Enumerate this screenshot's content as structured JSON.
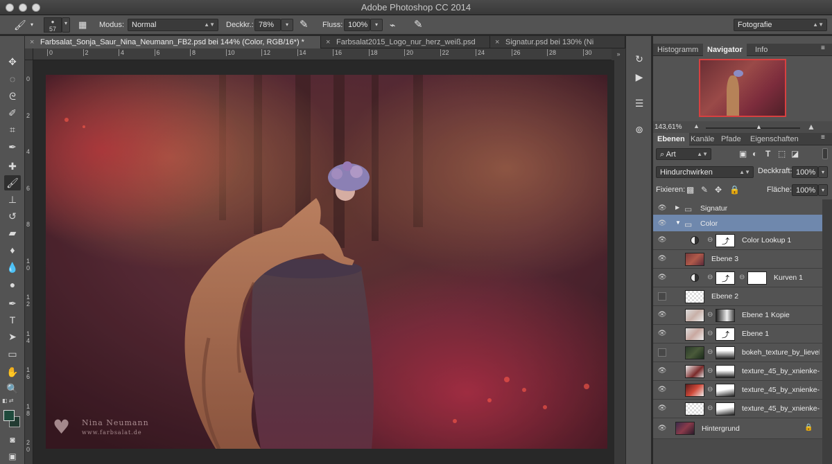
{
  "app": {
    "title": "Adobe Photoshop CC 2014"
  },
  "options": {
    "brush_size": "57",
    "mode_label": "Modus:",
    "mode_value": "Normal",
    "opacity_label": "Deckkr.:",
    "opacity_value": "78%",
    "flow_label": "Fluss:",
    "flow_value": "100%",
    "workspace": "Fotografie"
  },
  "doc_tabs": [
    {
      "label": "Farbsalat_Sonja_Saur_Nina_Neumann_FB2.psd bei 144% (Color, RGB/16*) *",
      "active": true
    },
    {
      "label": "Farbsalat2015_Logo_nur_herz_weiß.psd",
      "active": false
    },
    {
      "label": "Signatur.psd bei 130% (Ni",
      "active": false
    }
  ],
  "ruler_h": [
    "0",
    "2",
    "4",
    "6",
    "8",
    "10",
    "12",
    "14",
    "16",
    "18",
    "20",
    "22",
    "24",
    "26",
    "28",
    "30",
    "3"
  ],
  "ruler_v": [
    "0",
    "2",
    "4",
    "6",
    "8",
    "1\n0",
    "1\n2",
    "1\n4",
    "1\n6",
    "1\n8",
    "2\n0"
  ],
  "watermark": {
    "line1": "Nina Neumann",
    "line2": "www.farbsalat.de"
  },
  "top_panel": {
    "tabs": [
      "Histogramm",
      "Navigator",
      "Info"
    ],
    "active_tab": "Navigator",
    "zoom": "143,61%"
  },
  "layers_panel": {
    "tabs": [
      "Ebenen",
      "Kanäle",
      "Pfade",
      "Eigenschaften"
    ],
    "active_tab": "Ebenen",
    "filter": "Art",
    "blend_mode": "Hindurchwirken",
    "opacity_label": "Deckkraft:",
    "opacity_value": "100%",
    "lock_label": "Fixieren:",
    "fill_label": "Fläche:",
    "fill_value": "100%",
    "layers": [
      {
        "name": "Signatur",
        "kind": "group",
        "expanded": false,
        "visible": true
      },
      {
        "name": "Color",
        "kind": "group",
        "expanded": true,
        "visible": true,
        "selected": true
      },
      {
        "name": "Color Lookup 1",
        "kind": "adjustment",
        "visible": true
      },
      {
        "name": "Ebene 3",
        "kind": "pixel",
        "visible": true
      },
      {
        "name": "Kurven 1",
        "kind": "adjustment",
        "visible": true
      },
      {
        "name": "Ebene 2",
        "kind": "pixel",
        "visible": false
      },
      {
        "name": "Ebene 1 Kopie",
        "kind": "pixel-mask",
        "visible": true
      },
      {
        "name": "Ebene 1",
        "kind": "pixel-mask",
        "visible": true
      },
      {
        "name": "bokeh_texture_by_lieveh...",
        "kind": "pixel-mask",
        "visible": false
      },
      {
        "name": "texture_45_by_xnienke-...",
        "kind": "smart-mask",
        "visible": true
      },
      {
        "name": "texture_45_by_xnienke-...",
        "kind": "smart-mask",
        "visible": true
      },
      {
        "name": "texture_45_by_xnienke-...",
        "kind": "smart-mask",
        "visible": true
      },
      {
        "name": "Hintergrund",
        "kind": "background",
        "visible": true
      }
    ]
  }
}
